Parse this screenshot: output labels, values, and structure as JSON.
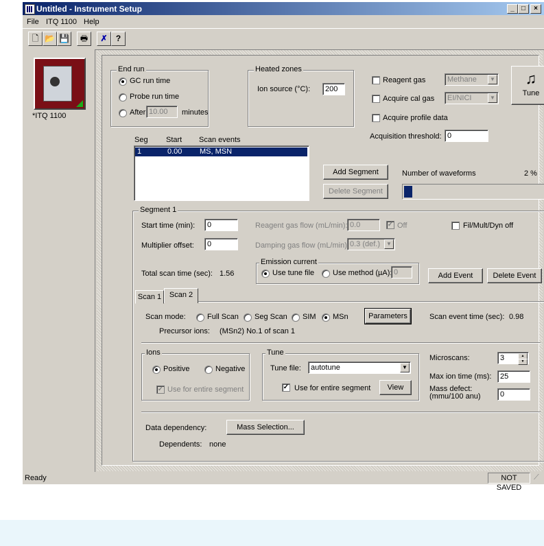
{
  "window": {
    "title": "Untitled - Instrument Setup",
    "minimize": "_",
    "maximize": "□",
    "close": "×"
  },
  "menu": [
    "File",
    "ITQ 1100",
    "Help"
  ],
  "toolbar": {
    "new": "🗋",
    "open": "📂",
    "save": "💾",
    "print": "🖶",
    "cut": "✗",
    "help": "?"
  },
  "device": {
    "label": "*ITQ 1100"
  },
  "end_run": {
    "caption": "End run",
    "gc": "GC run time",
    "probe": "Probe run time",
    "after": "After",
    "after_value": "10.00",
    "minutes": "minutes",
    "selected": "gc"
  },
  "heated_zones": {
    "caption": "Heated zones",
    "ion_source_label": "Ion source (°C):",
    "ion_source_value": "200"
  },
  "reagent": {
    "label": "Reagent gas",
    "value": "Methane"
  },
  "cal_gas": {
    "label": "Acquire cal gas",
    "value": "EI/NICI"
  },
  "profile": {
    "label": "Acquire profile data"
  },
  "tune_button": {
    "label": "Tune",
    "icon": "music-note-icon"
  },
  "threshold": {
    "label": "Acquisition threshold:",
    "value": "0"
  },
  "segments": {
    "headers": [
      "Seg",
      "Start",
      "Scan events"
    ],
    "rows": [
      {
        "seg": "1",
        "start": "0.00",
        "events": "MS, MSN"
      }
    ]
  },
  "segment_buttons": {
    "add": "Add Segment",
    "delete": "Delete Segment"
  },
  "waveforms": {
    "label": "Number of waveforms",
    "percent": "2 %",
    "fraction": 0.02
  },
  "segment1": {
    "caption": "Segment 1",
    "start_label": "Start time (min):",
    "start_value": "0",
    "multiplier_label": "Multiplier offset:",
    "multiplier_value": "0",
    "reagent_flow_label": "Reagent gas flow (mL/min):",
    "reagent_flow_value": "0.0",
    "off_label": "Off",
    "damping_label": "Damping gas flow (mL/min):",
    "damping_value": "0.3 (def.)",
    "fil_label": "Fil/Mult/Dyn off",
    "scan_time_label": "Total scan time (sec):",
    "scan_time_value": "1.56",
    "emission_caption": "Emission current",
    "use_tune_file": "Use tune file",
    "use_method": "Use method (µA):",
    "method_value": "0",
    "add_event": "Add Event",
    "delete_event": "Delete Event"
  },
  "tabs": [
    "Scan 1",
    "Scan 2"
  ],
  "scan2": {
    "mode_label": "Scan mode:",
    "modes": [
      "Full Scan",
      "Seg Scan",
      "SIM",
      "MSn"
    ],
    "selected_mode": "MSn",
    "parameters": "Parameters",
    "event_time_label": "Scan event time (sec):",
    "event_time_value": "0.98",
    "precursor_label": "Precursor ions:",
    "precursor_value": "(MSn2) No.1 of scan 1",
    "ions_caption": "Ions",
    "positive": "Positive",
    "negative": "Negative",
    "use_entire": "Use for entire segment",
    "tune_caption": "Tune",
    "tune_file_label": "Tune file:",
    "tune_file_value": "autotune",
    "tune_use_entire": "Use for entire segment",
    "view": "View",
    "microscans_label": "Microscans:",
    "microscans_value": "3",
    "max_ion_label": "Max ion time (ms):",
    "max_ion_value": "25",
    "mass_defect_label_1": "Mass defect:",
    "mass_defect_label_2": "(mmu/100 anu)",
    "mass_defect_value": "0",
    "data_dep_label": "Data dependency:",
    "mass_selection": "Mass Selection...",
    "dependents_label": "Dependents:",
    "dependents_value": "none"
  },
  "status": {
    "left": "Ready",
    "right": "NOT SAVED"
  }
}
